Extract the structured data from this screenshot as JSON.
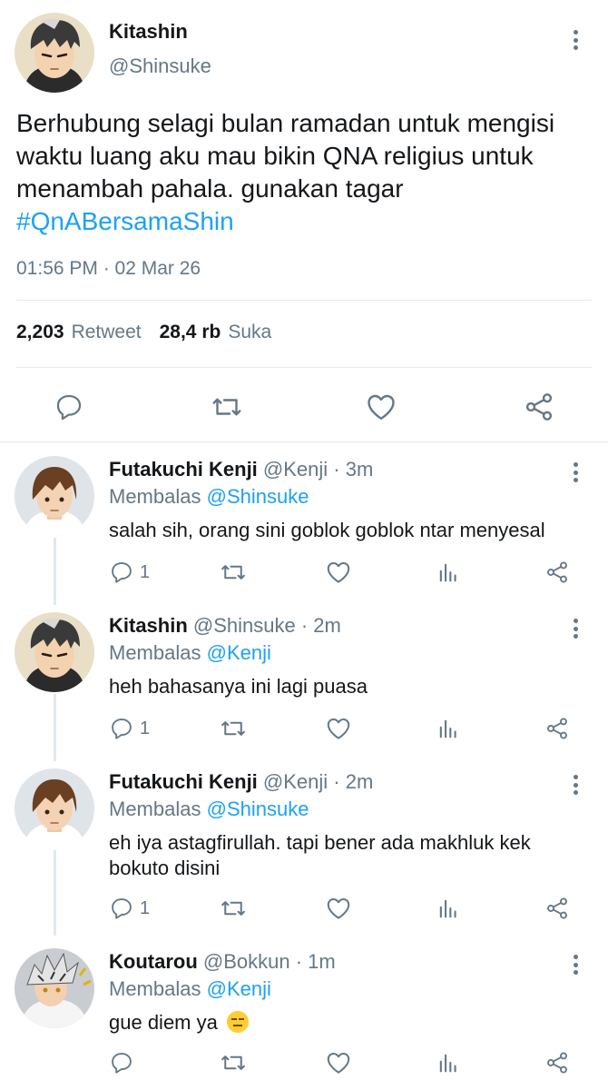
{
  "main_tweet": {
    "name": "Kitashin",
    "handle": "@Shinsuke",
    "text": "Berhubung selagi bulan ramadan untuk mengisi waktu luang aku mau bikin QNA religius untuk menambah pahala. gunakan tagar",
    "hashtag": "#QnABersamaShin",
    "timestamp": "01:56 PM · 02 Mar 26",
    "retweet_count": "2,203",
    "retweet_label": "Retweet",
    "like_count": "28,4 rb",
    "like_label": "Suka"
  },
  "replies": [
    {
      "name": "Futakuchi Kenji",
      "meta": "@Kenji · 3m",
      "replying_label": "Membalas",
      "replying_to": "@Shinsuke",
      "text": "salah sih, orang sini goblok goblok ntar menyesal",
      "reply_count": "1"
    },
    {
      "name": "Kitashin",
      "meta": "@Shinsuke · 2m",
      "replying_label": "Membalas",
      "replying_to": "@Kenji",
      "text": "heh bahasanya ini lagi puasa",
      "reply_count": "1"
    },
    {
      "name": "Futakuchi Kenji",
      "meta": "@Kenji · 2m",
      "replying_label": "Membalas",
      "replying_to": "@Shinsuke",
      "text": "eh iya astagfirullah. tapi bener ada makhluk kek bokuto disini",
      "reply_count": "1"
    },
    {
      "name": "Koutarou",
      "meta": "@Bokkun · 1m",
      "replying_label": "Membalas",
      "replying_to": "@Kenji",
      "text": "gue diem ya",
      "reply_count": ""
    }
  ],
  "colors": {
    "accent": "#1da1f2",
    "secondary_text": "#657786",
    "primary_text": "#14171a",
    "divider": "#e1e8ed"
  },
  "icons": [
    "reply-icon",
    "retweet-icon",
    "like-icon",
    "share-icon",
    "analytics-icon",
    "more-icon",
    "expressionless-emoji"
  ]
}
